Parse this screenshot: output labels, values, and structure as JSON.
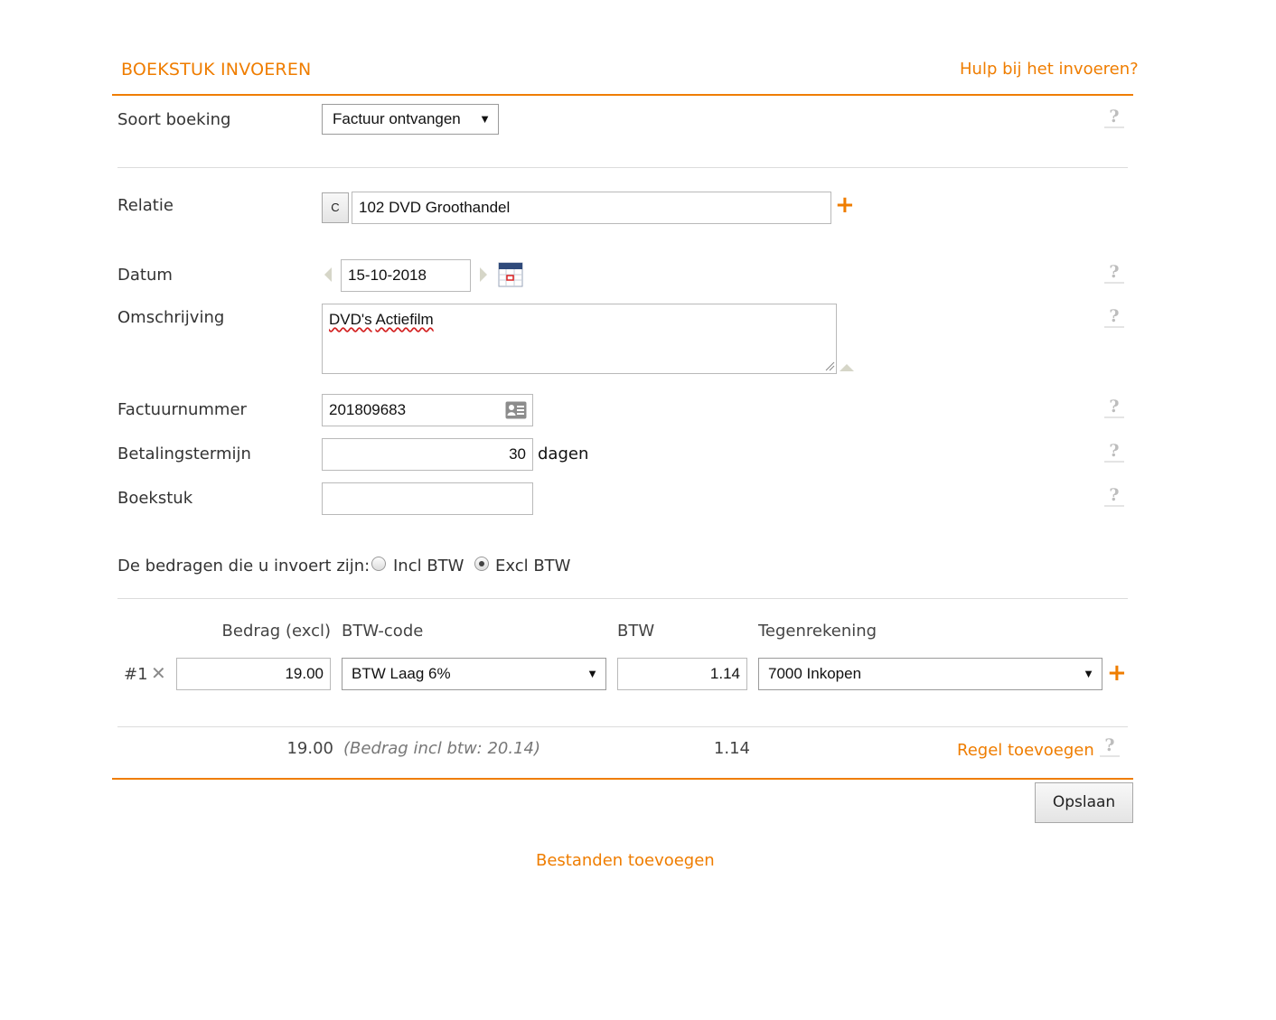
{
  "header": {
    "title": "BOEKSTUK INVOEREN",
    "help_link": "Hulp bij het invoeren?"
  },
  "form": {
    "soort_boeking": {
      "label": "Soort boeking",
      "value": "Factuur ontvangen"
    },
    "relatie": {
      "label": "Relatie",
      "code_button": "C",
      "value": "102 DVD Groothandel"
    },
    "datum": {
      "label": "Datum",
      "value": "15-10-2018"
    },
    "omschrijving": {
      "label": "Omschrijving",
      "value_word1": "DVD's",
      "value_word2": "Actiefilm"
    },
    "factuurnummer": {
      "label": "Factuurnummer",
      "value": "201809683"
    },
    "betalingstermijn": {
      "label": "Betalingstermijn",
      "value": "30",
      "unit": "dagen"
    },
    "boekstuk": {
      "label": "Boekstuk",
      "value": ""
    },
    "bedragen": {
      "label": "De bedragen die u invoert zijn:",
      "option_incl": "Incl BTW",
      "option_excl": "Excl BTW",
      "selected": "Excl BTW"
    }
  },
  "lines": {
    "headers": {
      "bedrag": "Bedrag (excl)",
      "btw_code": "BTW-code",
      "btw": "BTW",
      "tegenrekening": "Tegenrekening"
    },
    "rows": [
      {
        "index": "#1",
        "bedrag": "19.00",
        "btw_code": "BTW Laag 6%",
        "btw": "1.14",
        "tegenrekening": "7000 Inkopen"
      }
    ],
    "totals": {
      "bedrag": "19.00",
      "incl_note": "(Bedrag incl btw: 20.14)",
      "btw": "1.14"
    },
    "add_line": "Regel toevoegen"
  },
  "actions": {
    "save": "Opslaan",
    "add_files": "Bestanden toevoegen"
  },
  "icons": {
    "help": "?",
    "plus": "+",
    "remove": "✕",
    "dropdown": "▼"
  },
  "colors": {
    "accent": "#ef7d00"
  }
}
